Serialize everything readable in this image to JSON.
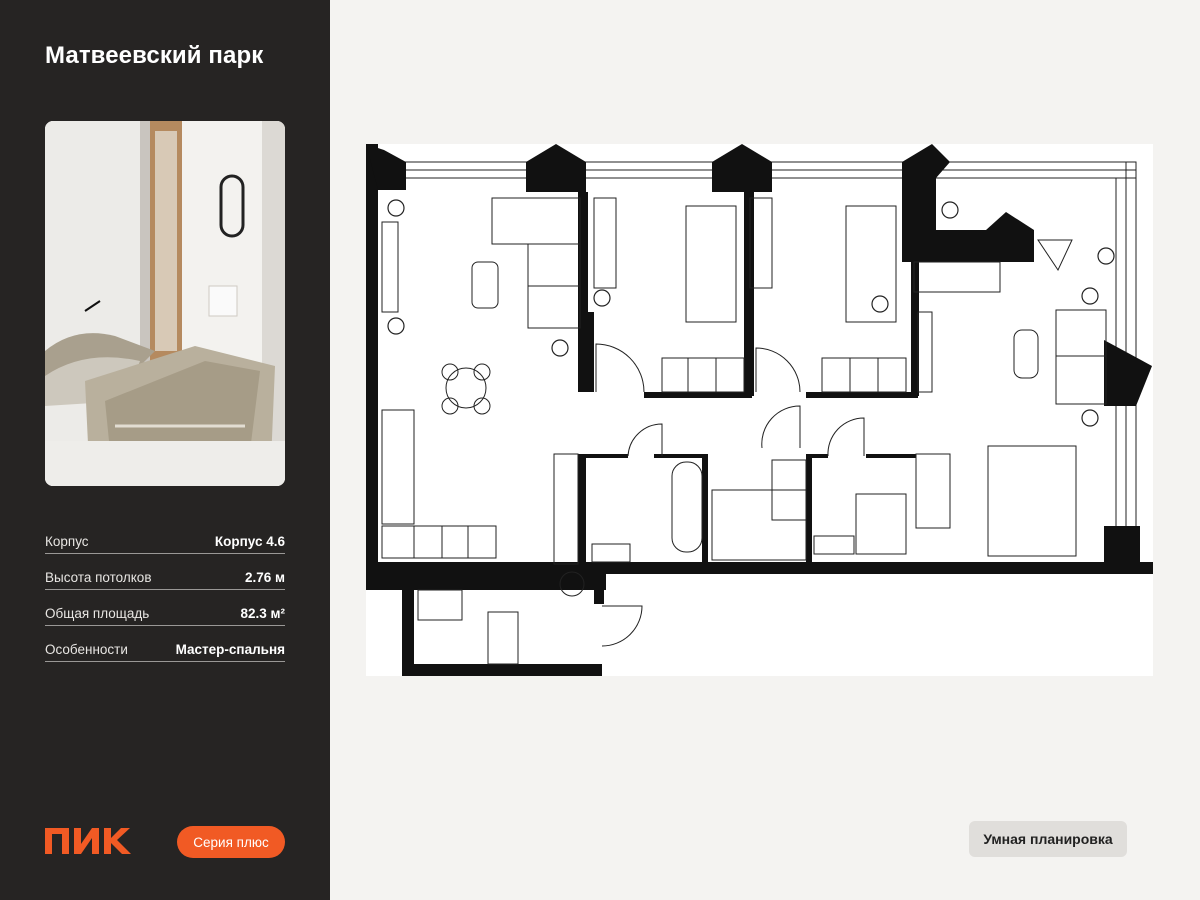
{
  "project": {
    "title": "Матвеевский парк"
  },
  "specs": [
    {
      "label": "Корпус",
      "value": "Корпус 4.6"
    },
    {
      "label": "Высота потолков",
      "value": "2.76 м"
    },
    {
      "label": "Общая площадь",
      "value": "82.3 м²"
    },
    {
      "label": "Особенности",
      "value": "Мастер-спальня"
    }
  ],
  "brand": {
    "logo_text": "ПИК",
    "series_label": "Серия плюс",
    "accent_color": "#f15a24"
  },
  "photo": {
    "icon": "bedroom-photo"
  },
  "floor_plan": {
    "icon": "floor-plan"
  },
  "actions": {
    "smart_layout_label": "Умная планировка"
  }
}
